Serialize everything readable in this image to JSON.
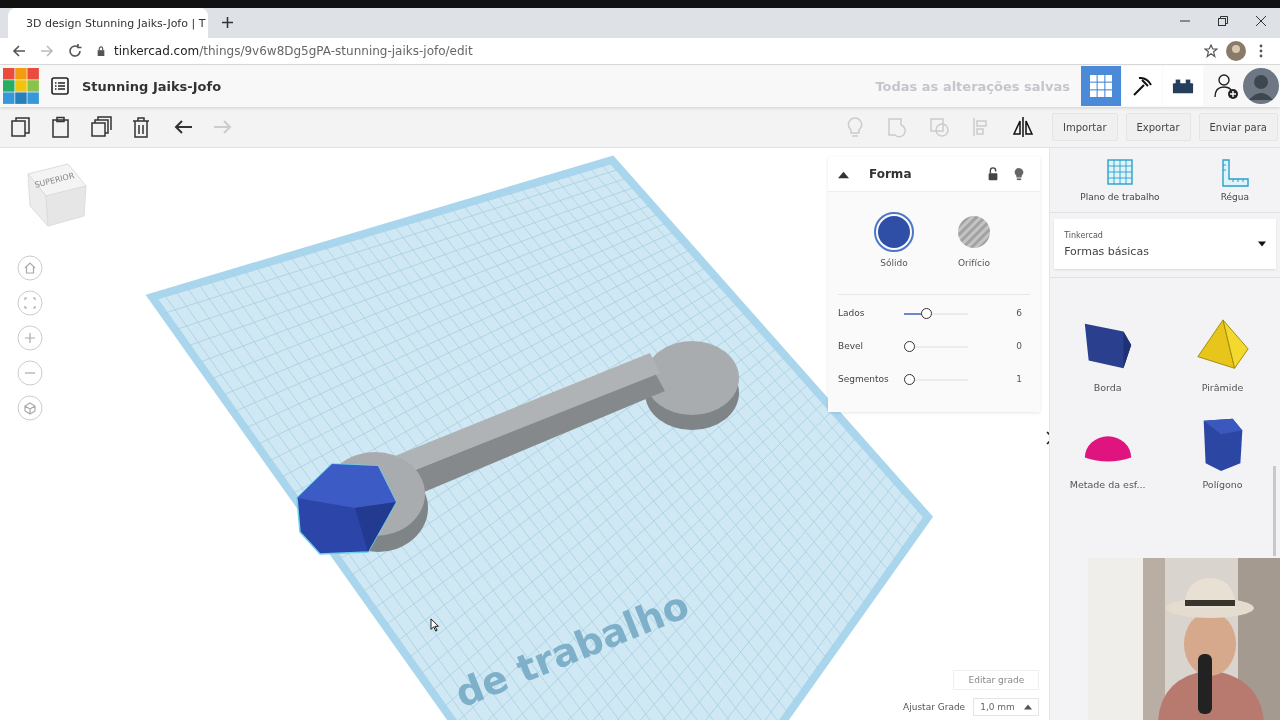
{
  "browser": {
    "tab_title": "3D design Stunning Jaiks-Jofo | T",
    "url_host": "tinkercad.com",
    "url_path": "/things/9v6w8Dg5gPA-stunning-jaiks-jofo/edit"
  },
  "header": {
    "project_title": "Stunning Jaiks-Jofo",
    "save_status": "Todas as alterações salvas",
    "views": [
      {
        "kind": "grid",
        "selected": true
      },
      {
        "kind": "pickaxe",
        "selected": false
      },
      {
        "kind": "bricks",
        "selected": false
      }
    ]
  },
  "toolbar": {
    "edit_tools": [
      {
        "kind": "copy",
        "disabled": false
      },
      {
        "kind": "paste",
        "disabled": false
      },
      {
        "kind": "duplicate",
        "disabled": false
      },
      {
        "kind": "delete",
        "disabled": false
      },
      {
        "kind": "undo",
        "disabled": false
      },
      {
        "kind": "redo",
        "disabled": true
      }
    ],
    "shape_tools": [
      {
        "kind": "bulb",
        "disabled": true
      },
      {
        "kind": "group",
        "disabled": true
      },
      {
        "kind": "ungroup",
        "disabled": true
      },
      {
        "kind": "align",
        "disabled": true
      },
      {
        "kind": "mirror",
        "disabled": false
      }
    ],
    "buttons": [
      "Importar",
      "Exportar",
      "Enviar para"
    ]
  },
  "canvas": {
    "view_cube": "SUPERIOR",
    "workplane_label": "de trabalho",
    "edit_grid": "Editar grade",
    "snap_grid": {
      "label": "Ajustar Grade",
      "value": "1,0 mm"
    }
  },
  "inspector": {
    "title": "Forma",
    "locked": false,
    "modes": [
      {
        "label": "Sólido",
        "selected": true
      },
      {
        "label": "Orifício",
        "selected": false
      }
    ],
    "params": [
      {
        "name": "Lados",
        "level": 0.33,
        "value": "6"
      },
      {
        "name": "Bevel",
        "level": 0,
        "value": "0"
      },
      {
        "name": "Segmentos",
        "level": 0,
        "value": "1"
      }
    ]
  },
  "panel": {
    "tools": [
      {
        "kind": "workplane",
        "label": "Plano de trabalho"
      },
      {
        "kind": "ruler",
        "label": "Régua"
      }
    ],
    "library": {
      "label": "Tinkercad",
      "value": "Formas básicas"
    },
    "shapes": [
      {
        "kind": "wedge",
        "label": "Borda"
      },
      {
        "kind": "pyramid",
        "label": "Pirâmide"
      },
      {
        "kind": "half_sphere",
        "label": "Metade da esf..."
      },
      {
        "kind": "polygon",
        "label": "Polígono"
      }
    ]
  }
}
